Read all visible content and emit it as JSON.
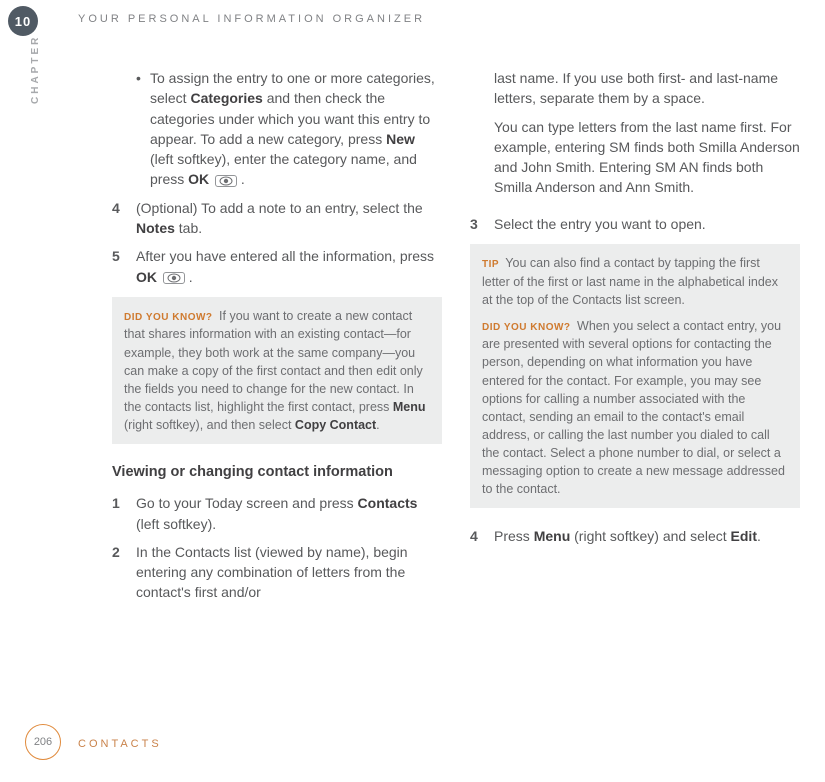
{
  "chapter_num": "10",
  "chapter_word": "CHAPTER",
  "header_title": "YOUR PERSONAL INFORMATION ORGANIZER",
  "page_num": "206",
  "footer_label": "CONTACTS",
  "ok_label": "OK",
  "col1": {
    "bullet_a": "To assign the entry to one or more categories, select ",
    "bullet_b": "Categories",
    "bullet_c": " and then check the categories under which you want this entry to appear. To add a new category, press ",
    "bullet_d": "New",
    "bullet_e": " (left softkey), enter the category name, and press ",
    "bullet_f": "OK",
    "step4_num": "4",
    "step4_a": "(Optional) To add a note to an entry, select the ",
    "step4_b": "Notes",
    "step4_c": " tab.",
    "step5_num": "5",
    "step5_a": "After you have entered all the information, press ",
    "step5_b": "OK",
    "dyk_lead": "DID YOU KNOW?",
    "dyk_a": " If you want to create a new contact that shares information with an existing contact—for example, they both work at the same company—you can make a copy of the first contact and then edit only the fields you need to change for the new contact. In the contacts list, highlight the first contact, press ",
    "dyk_b": "Menu",
    "dyk_c": " (right softkey), and then select ",
    "dyk_d": "Copy Contact",
    "dyk_e": ".",
    "heading2": "Viewing or changing contact information",
    "v1_num": "1",
    "v1_a": "Go to your Today screen and press ",
    "v1_b": "Contacts",
    "v1_c": " (left softkey).",
    "v2_num": "2",
    "v2_a": "In the Contacts list (viewed by name), begin entering any combination of letters from the contact's first and/or"
  },
  "col2": {
    "cont_a": "last name. If you use both first- and last-name letters, separate them by a space.",
    "cont_b": "You can type letters from the last name first. For example, entering SM finds both Smilla Anderson and John Smith. Entering SM AN finds both Smilla Anderson and Ann Smith.",
    "v3_num": "3",
    "v3_a": "Select the entry you want to open.",
    "tip_lead": "TIP",
    "tip_body": " You can also find a contact by tapping the first letter of the first or last name in the alphabetical index at the top of the Contacts list screen.",
    "dyk2_lead": "DID YOU KNOW?",
    "dyk2_body": " When you select a contact entry, you are presented with several options for contacting the person, depending on what information you have entered for the contact. For example, you may see options for calling a number associated with the contact, sending an email to the contact's email address, or calling the last number you dialed to call the contact. Select a phone number to dial, or select a messaging option to create a new message addressed to the contact.",
    "v4_num": "4",
    "v4_a": "Press ",
    "v4_b": "Menu",
    "v4_c": " (right softkey) and select ",
    "v4_d": "Edit",
    "v4_e": "."
  }
}
